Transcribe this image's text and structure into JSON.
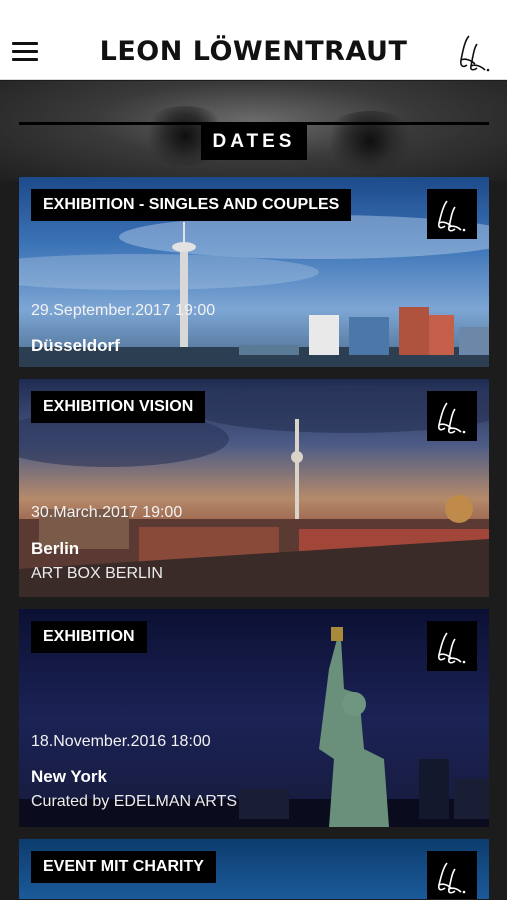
{
  "app": {
    "title": "LEON LÖWENTRAUT",
    "menu_icon": "hamburger-menu-icon",
    "logo_icon": "ll-monogram-logo-icon",
    "status_color": "#33cc55"
  },
  "hero": {
    "section_label": "DATES"
  },
  "events": [
    {
      "tag": "EXHIBITION - SINGLES AND COUPLES",
      "date": "29.September.2017 19:00",
      "city": "Düsseldorf",
      "subtitle": ""
    },
    {
      "tag": "EXHIBITION VISION",
      "date": "30.March.2017 19:00",
      "city": "Berlin",
      "subtitle": "ART BOX BERLIN"
    },
    {
      "tag": "EXHIBITION",
      "date": "18.November.2016 18:00",
      "city": "New York",
      "subtitle": "Curated by EDELMAN ARTS"
    },
    {
      "tag": "EVENT MIT CHARITY",
      "date": "",
      "city": "",
      "subtitle": ""
    }
  ]
}
